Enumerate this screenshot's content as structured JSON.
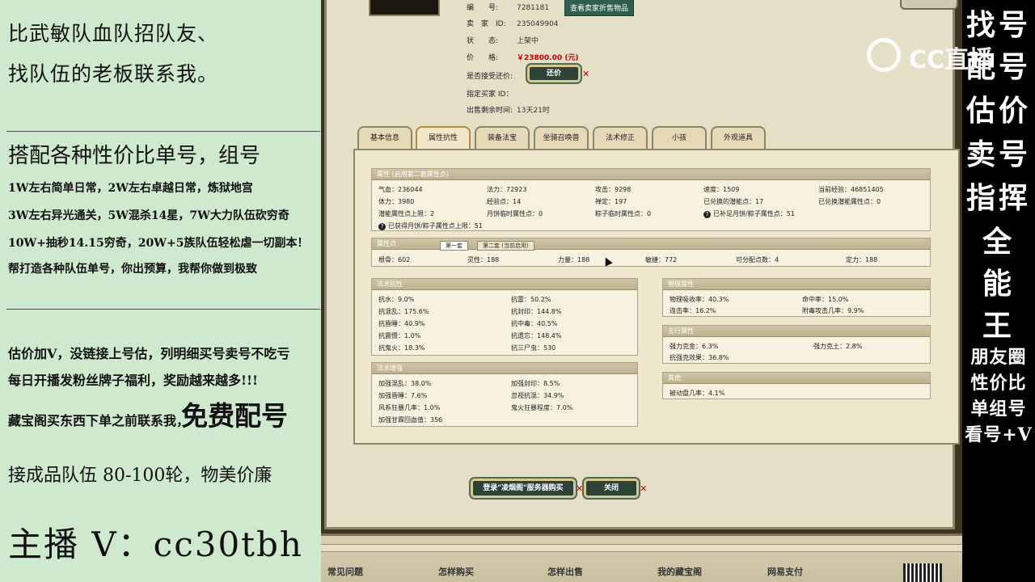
{
  "left_panel": {
    "l1": "比武敏队血队招队友、",
    "l2": "找队伍的老板联系我。",
    "l3": "搭配各种性价比单号，组号",
    "l4": "1W左右简单日常，2W左右卓越日常，炼狱地宫",
    "l5": "3W左右异光通关，5W混杀14星，7W大力队伍砍穷奇",
    "l6": "10W+抽秒14.15穷奇，20W+5族队伍轻松虐一切副本！",
    "l7": "帮打造各种队伍单号，你出预算，我帮你做到极致",
    "l8": "估价加V，没链接上号估，列明细买号卖号不吃亏",
    "l9": "每日开播发粉丝牌子福利，奖励越来越多!!!",
    "l10a": "藏宝阁买东西下单之前联系我，",
    "l10b": "免费配号",
    "l11": "接成品队伍 80-100轮，物美价廉",
    "l12": "主播 V：cc30tbh"
  },
  "right_panel": {
    "r1": "找号",
    "r2": "配号",
    "r3": "估价",
    "r4": "卖号",
    "r5": "指挥",
    "r6": "全",
    "r7": "能",
    "r8": "王",
    "r9": "朋友圈",
    "r10": "性价比",
    "r11": "单组号",
    "r12": "看号+V",
    "logo": "CC直播"
  },
  "listing": {
    "id_label": "编　　号:",
    "id_value": "7281181",
    "seller_label": "卖　家　ID:",
    "seller_value": "235049904",
    "status_label": "状　　态:",
    "status_value": "上架中",
    "price_label": "价　　格:",
    "price_value": "￥23800.00 (元)",
    "bargain_label": "是否接受还价:",
    "bargain_button": "还价",
    "buyer_label": "指定买家 ID：",
    "time_label": "出售剩余时间:",
    "time_value": "13天21时",
    "seller_items_button": "查看卖家折售物品"
  },
  "tabs": [
    "基本信息",
    "属性抗性",
    "装备法宝",
    "坐骑召唤兽",
    "法术修正",
    "小孩",
    "外观道具"
  ],
  "attr_panel": {
    "title": "属性 (启用第二套属性点)",
    "cells": [
      "气血：236044",
      "法力：72923",
      "攻击：9298",
      "速度：1509",
      "当前经验：46851405",
      "体力：3980",
      "经验点：14",
      "禅定：197",
      "已兑换的潜能点：17",
      "已兑换潜能属性点：0",
      "潜能属性点上限：2",
      "月饼临时属性点：0",
      "粽子临时属性点：0",
      "已补足月饼/粽子属性点：51"
    ],
    "note": "已获得月饼/粽子属性点上限：51"
  },
  "points_panel": {
    "title": "属性点",
    "tab1": "第一套",
    "tab2": "第二套 (当前启用)",
    "cells": [
      "根骨：602",
      "灵性：188",
      "力量：188",
      "敏捷：772",
      "可分配点数：4",
      "定力：188"
    ]
  },
  "resist_panel": {
    "title": "法术抗性",
    "cells": [
      "抗水：9.0%",
      "抗雷：50.2%",
      "抗混乱：175.6%",
      "抗封印：144.8%",
      "抗昏睡：40.9%",
      "抗中毒：40.5%",
      "抗震慑：1.0%",
      "抗遗忘：148.4%",
      "抗鬼火：18.3%",
      "抗三尸虫：530"
    ]
  },
  "boost_panel": {
    "title": "法术增强",
    "cells": [
      "加强混乱：38.0%",
      "加强封印：8.5%",
      "加强昏睡：7.6%",
      "忽视抗混：34.9%",
      "风系狂暴几率：1.0%",
      "鬼火狂暴程度：7.0%",
      "加强甘霖回血值：356"
    ]
  },
  "physical_panel": {
    "title": "物理属性",
    "cells": [
      "物理吸收率：40.3%",
      "命中率：15.0%",
      "连击率：16.2%",
      "附毒攻击几率：9.9%"
    ]
  },
  "five_panel": {
    "title": "五行属性",
    "cells": [
      "强力克金：6.3%",
      "强力克土：2.8%",
      "抗强克效果：36.8%"
    ]
  },
  "other_panel": {
    "title": "其他",
    "cells": [
      "被动盘几率：4.1%"
    ]
  },
  "buttons": {
    "buy": "登录\"凌烟阁\"服务器购买",
    "close": "关闭"
  },
  "footer": [
    "常见问题",
    "怎样购买",
    "怎样出售",
    "我的藏宝阁",
    "网易支付"
  ]
}
